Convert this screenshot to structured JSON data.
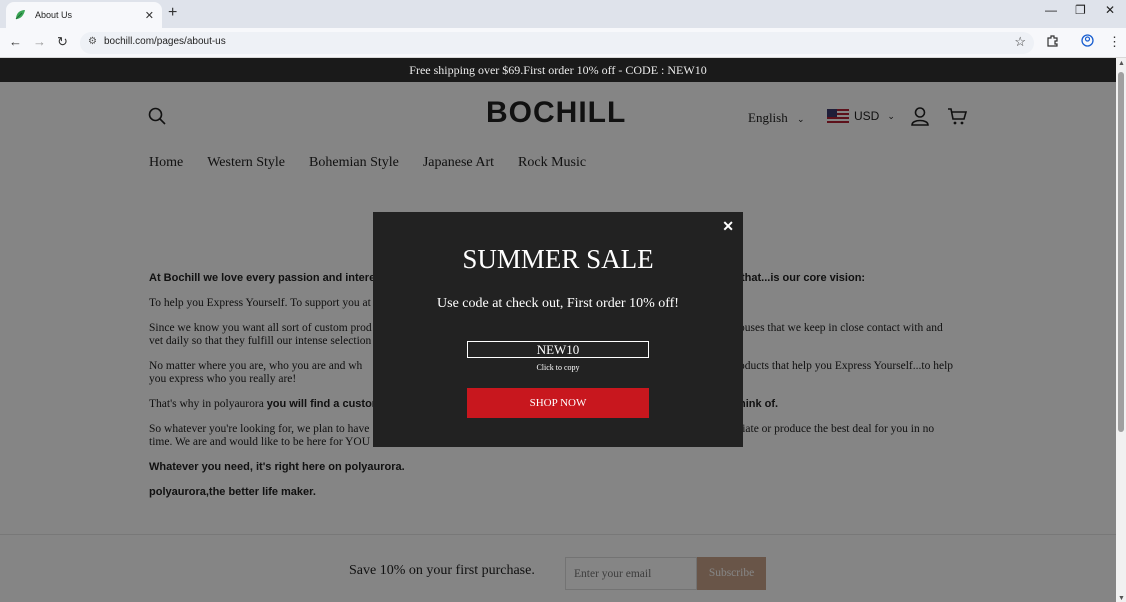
{
  "browser": {
    "tab_title": "About Us",
    "tab_close": "✕",
    "new_tab": "+",
    "url": "bochill.com/pages/about-us",
    "win_min": "—",
    "win_restore": "❐",
    "win_close": "✕"
  },
  "announcement": "Free shipping over $69.First order 10% off - CODE : NEW10",
  "header": {
    "logo": "BOCHILL",
    "language": "English",
    "currency": "USD"
  },
  "nav": [
    "Home",
    "Western Style",
    "Bohemian Style",
    "Japanese Art",
    "Rock Music"
  ],
  "content": {
    "p1": "At Bochill we love every passion and interest or",
    "p1b": "that...is our core vision:",
    "p2": "To help you Express Yourself. To support you at",
    "p3a": "Since we know you want all sort of custom prod",
    "p3b": "ouses that we keep in close contact with and",
    "p3c": "vet daily so that they fulfill our intense selection",
    "p4a": "No matter where you are, who you are and wh",
    "p4b": "oducts that help you Express Yourself...to help",
    "p4c": "you express who you really are!",
    "p5a": "That's why in polyaurora",
    "p5b": "you will find a custom",
    "p5c": "hink of.",
    "p6a": "So whatever you're looking for, we plan to have",
    "p6b": "tiate or produce the best deal for you in no",
    "p6c": "time. We are and would like to be here for YOU",
    "p7": "Whatever you need, it's right here on polyaurora.",
    "p8": "polyaurora,the better life maker."
  },
  "newsletter": {
    "text": "Save 10% on your first purchase.",
    "placeholder": "Enter your email",
    "button": "Subscribe"
  },
  "popup": {
    "close": "✕",
    "title": "SUMMER SALE",
    "subtitle": "Use code at check out, First order 10% off!",
    "code": "NEW10",
    "copy_hint": "Click to copy",
    "button": "SHOP NOW"
  },
  "colors": {
    "announcement_bg": "#1a1a1a",
    "popup_bg": "#222222",
    "shop_button": "#c8171e",
    "subscribe_button": "#c9a48a"
  },
  "icons": [
    "search-icon",
    "account-icon",
    "cart-icon",
    "chevron-down-icon",
    "close-icon",
    "star-icon",
    "extensions-icon",
    "profile-icon",
    "menu-icon"
  ]
}
